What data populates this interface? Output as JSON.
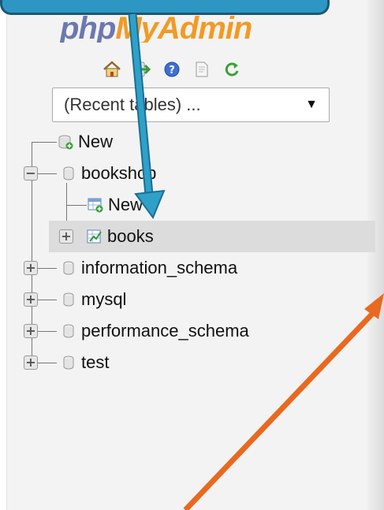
{
  "logo": {
    "part1": "php",
    "part2": "MyAdmin"
  },
  "toolbar": {
    "icons": [
      "home-icon",
      "logout-icon",
      "help-icon",
      "docs-icon",
      "reload-icon"
    ]
  },
  "recent_select": {
    "value": "(Recent tables) ...",
    "caret": "▼"
  },
  "tree": {
    "new_db": "New",
    "databases": [
      {
        "name": "bookshop",
        "expanded": true,
        "toggle": "−"
      },
      {
        "name": "information_schema",
        "expanded": false,
        "toggle": "+"
      },
      {
        "name": "mysql",
        "expanded": false,
        "toggle": "+"
      },
      {
        "name": "performance_schema",
        "expanded": false,
        "toggle": "+"
      },
      {
        "name": "test",
        "expanded": false,
        "toggle": "+"
      }
    ],
    "bookshop_children": {
      "new_table": "New",
      "tables": [
        {
          "name": "books",
          "toggle": "+",
          "selected": true
        }
      ]
    }
  },
  "colors": {
    "logo_php": "#6c78af",
    "logo_admin": "#f29a24",
    "callout": "#2e96c2",
    "arrow_blue": "#2fa0c8",
    "arrow_orange": "#e9691f",
    "selected_row": "#dcdcdc"
  }
}
